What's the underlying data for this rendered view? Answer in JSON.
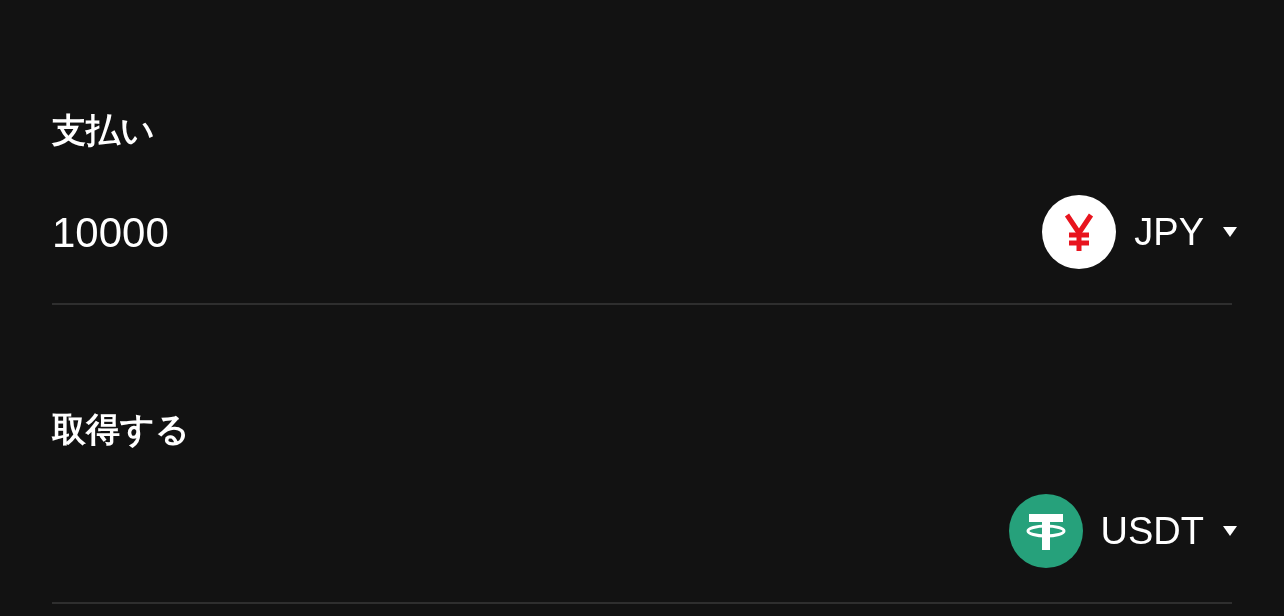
{
  "sections": [
    {
      "label": "支払い",
      "amount": "10000",
      "currency": {
        "code": "JPY",
        "kind": "yen"
      }
    },
    {
      "label": "取得する",
      "currency": {
        "code": "USDT",
        "kind": "tether"
      }
    }
  ]
}
